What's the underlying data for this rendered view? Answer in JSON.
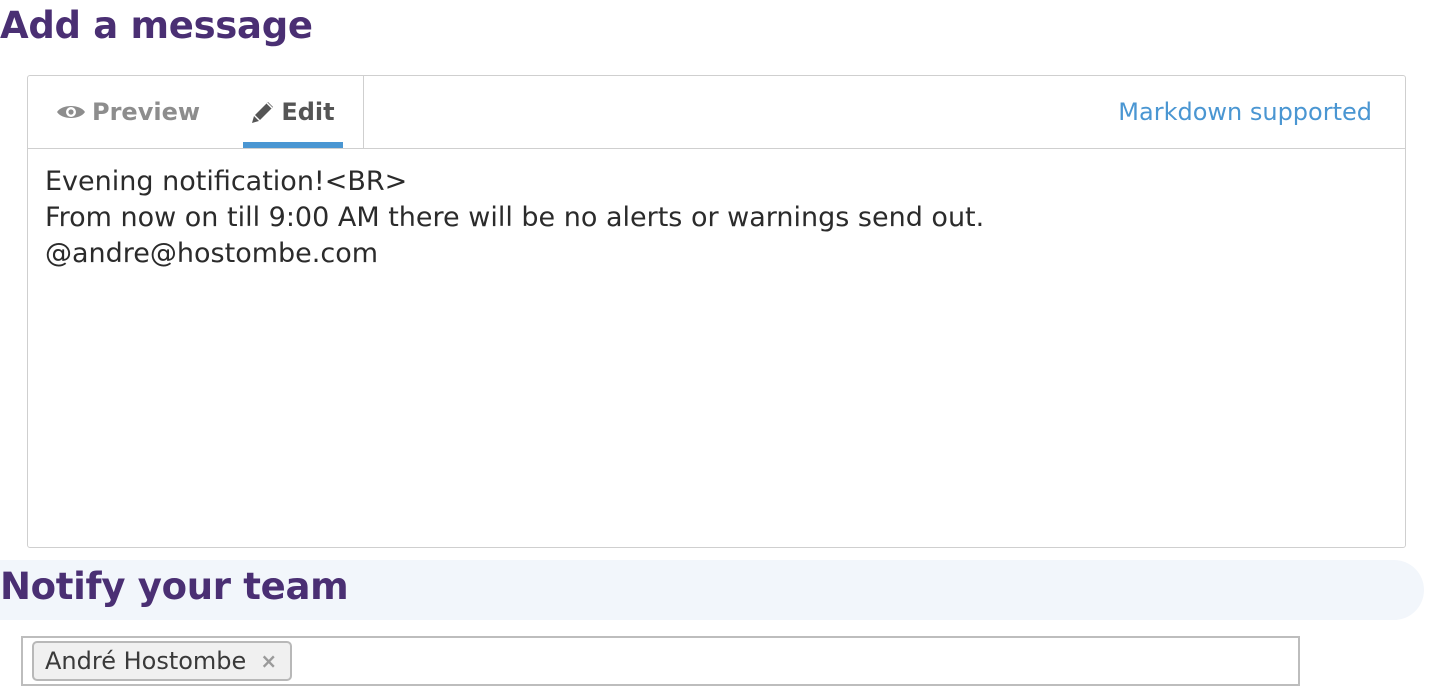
{
  "message_section": {
    "title": "Add a message",
    "tabs": [
      {
        "label": "Preview",
        "icon": "eye-icon",
        "active": false
      },
      {
        "label": "Edit",
        "icon": "pencil-icon",
        "active": true
      }
    ],
    "markdown_link": "Markdown supported",
    "message_text": "Evening notification!<BR>\nFrom now on till 9:00 AM there will be no alerts or warnings send out.\n@andre@hostombe.com"
  },
  "notify_section": {
    "title": "Notify your team",
    "recipients": [
      {
        "name": "André Hostombe",
        "remove_glyph": "×"
      }
    ]
  },
  "colors": {
    "heading": "#4a2f73",
    "accent": "#4a96d2",
    "band_background": "#f2f6fb"
  }
}
